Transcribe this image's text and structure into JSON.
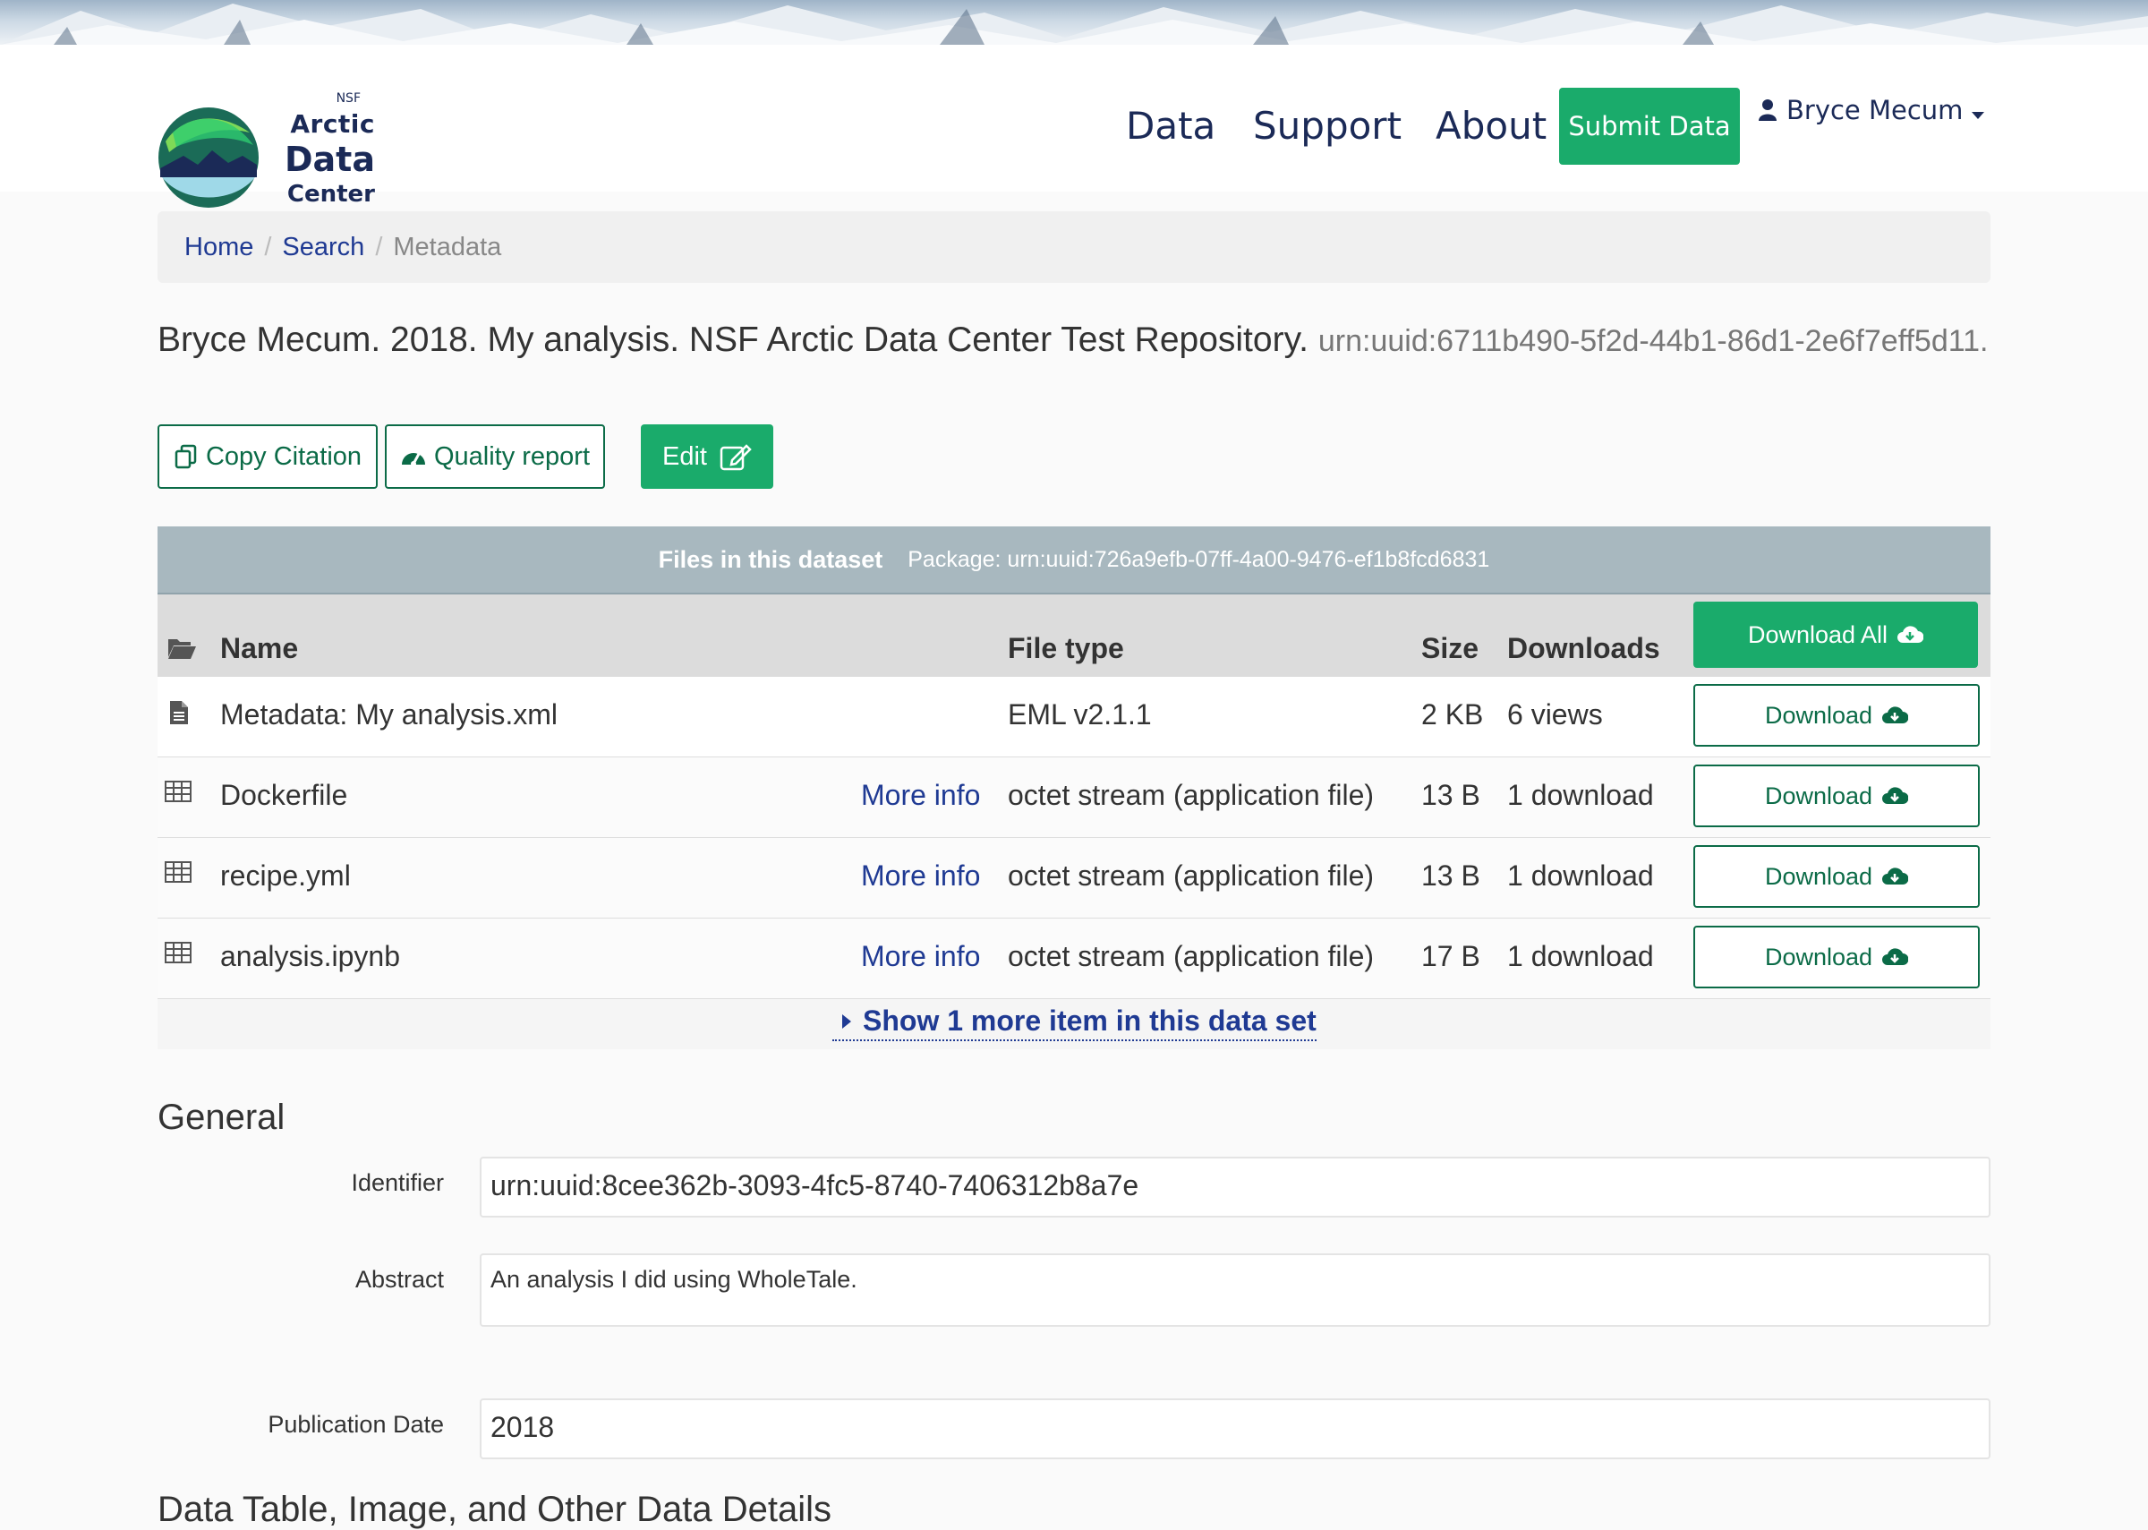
{
  "logo": {
    "nsf": "NSF",
    "line1": "Arctic",
    "line2": "Data",
    "line3": "Center"
  },
  "nav": {
    "data": "Data",
    "support": "Support",
    "about": "About",
    "submit": "Submit Data",
    "user": "Bryce Mecum"
  },
  "breadcrumb": {
    "home": "Home",
    "search": "Search",
    "current": "Metadata"
  },
  "citation": {
    "text": "Bryce Mecum. 2018. My analysis. NSF Arctic Data Center Test Repository.",
    "identifier": "urn:uuid:6711b490-5f2d-44b1-86d1-2e6f7eff5d11."
  },
  "actions": {
    "copy_citation": "Copy Citation",
    "quality_report": "Quality report",
    "edit": "Edit"
  },
  "files": {
    "title": "Files in this dataset",
    "package": "Package: urn:uuid:726a9efb-07ff-4a00-9476-ef1b8fcd6831",
    "headers": {
      "name": "Name",
      "type": "File type",
      "size": "Size",
      "downloads": "Downloads"
    },
    "download_all": "Download All",
    "rows": [
      {
        "name": "Metadata: My analysis.xml",
        "more_info": "",
        "type": "EML v2.1.1",
        "size": "2 KB",
        "downloads": "6 views",
        "button": "Download"
      },
      {
        "name": "Dockerfile",
        "more_info": "More info",
        "type": "octet stream (application file)",
        "size": "13 B",
        "downloads": "1 download",
        "button": "Download"
      },
      {
        "name": "recipe.yml",
        "more_info": "More info",
        "type": "octet stream (application file)",
        "size": "13 B",
        "downloads": "1 download",
        "button": "Download"
      },
      {
        "name": "analysis.ipynb",
        "more_info": "More info",
        "type": "octet stream (application file)",
        "size": "17 B",
        "downloads": "1 download",
        "button": "Download"
      }
    ],
    "show_more": "Show 1 more item in this data set"
  },
  "general": {
    "heading": "General",
    "identifier_label": "Identifier",
    "identifier_value": "urn:uuid:8cee362b-3093-4fc5-8740-7406312b8a7e",
    "abstract_label": "Abstract",
    "abstract_value": "An analysis I did using WholeTale.",
    "pubdate_label": "Publication Date",
    "pubdate_value": "2018"
  },
  "next_section": "Data Table, Image, and Other Data Details"
}
